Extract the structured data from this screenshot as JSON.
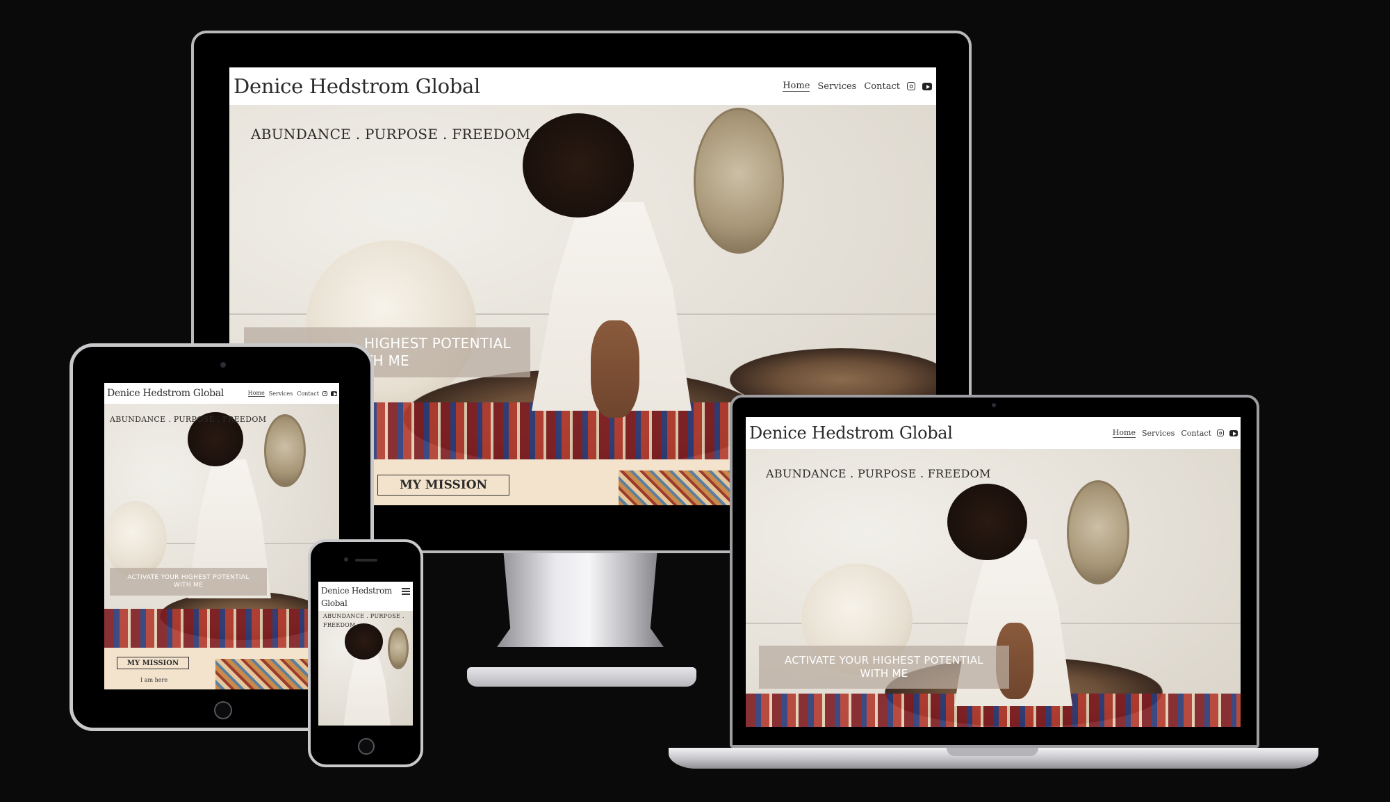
{
  "site": {
    "logo": "Denice Hedstrom Global",
    "logo_line1": "Denice Hedstrom",
    "logo_line2": "Global",
    "nav": {
      "home": "Home",
      "services": "Services",
      "contact": "Contact"
    },
    "icons": [
      "instagram-icon",
      "youtube-icon",
      "hamburger-menu-icon"
    ],
    "tagline": "ABUNDANCE . PURPOSE . FREEDOM",
    "tagline_phone_1": "ABUNDANCE . PURPOSE .",
    "tagline_phone_2": "FREEDOM",
    "cta_line1": "ACTIVATE YOUR HIGHEST POTENTIAL",
    "cta_line2": "WITH ME",
    "imac_cta_line1": "HIGHEST POTENTIAL",
    "imac_cta_line2": "TH ME",
    "mission_button": "MY MISSION",
    "tablet_footer_text": "I am here",
    "colors": {
      "background": "#0b0a0b",
      "header": "#ffffff",
      "mission_strip": "#f3e3cc",
      "cta_overlay": "#b9aca0"
    }
  }
}
